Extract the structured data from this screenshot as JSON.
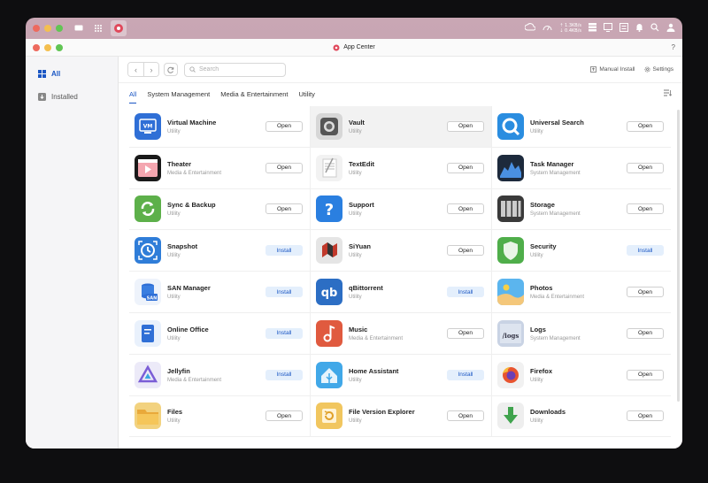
{
  "window": {
    "title": "App Center",
    "help": "?"
  },
  "sysbar": {
    "net_up": "1.3KB/s",
    "net_down": "0.4KB/s"
  },
  "sidebar": {
    "items": [
      {
        "label": "All",
        "icon": "grid-icon",
        "active": true
      },
      {
        "label": "Installed",
        "icon": "download-icon",
        "active": false
      }
    ]
  },
  "toolbar": {
    "search_placeholder": "Search",
    "manual_install": "Manual Install",
    "settings": "Settings"
  },
  "tabs": [
    "All",
    "System Management",
    "Media & Entertainment",
    "Utility"
  ],
  "apps": [
    {
      "name": "Virtual Machine",
      "category": "Utility",
      "action": "Open",
      "icon": "vm-icon",
      "color": "#2f6fd6"
    },
    {
      "name": "Vault",
      "category": "Utility",
      "action": "Open",
      "icon": "vault-icon",
      "color": "#6b6b6b"
    },
    {
      "name": "Universal Search",
      "category": "Utility",
      "action": "Open",
      "icon": "search-app-icon",
      "color": "#2a8de0"
    },
    {
      "name": "Theater",
      "category": "Media & Entertainment",
      "action": "Open",
      "icon": "theater-icon",
      "color": "#111111"
    },
    {
      "name": "TextEdit",
      "category": "Utility",
      "action": "Open",
      "icon": "textedit-icon",
      "color": "#eeeeee"
    },
    {
      "name": "Task Manager",
      "category": "System Management",
      "action": "Open",
      "icon": "task-manager-icon",
      "color": "#1d2a3c"
    },
    {
      "name": "Sync & Backup",
      "category": "Utility",
      "action": "Open",
      "icon": "sync-icon",
      "color": "#5db04a"
    },
    {
      "name": "Support",
      "category": "Utility",
      "action": "Open",
      "icon": "support-icon",
      "color": "#2a7fe0"
    },
    {
      "name": "Storage",
      "category": "System Management",
      "action": "Open",
      "icon": "storage-icon",
      "color": "#444444"
    },
    {
      "name": "Snapshot",
      "category": "Utility",
      "action": "Install",
      "icon": "snapshot-icon",
      "color": "#2f7dd8"
    },
    {
      "name": "SiYuan",
      "category": "Utility",
      "action": "Open",
      "icon": "siyuan-icon",
      "color": "#e5e5e5"
    },
    {
      "name": "Security",
      "category": "Utility",
      "action": "Install",
      "icon": "security-icon",
      "color": "#4fae4a"
    },
    {
      "name": "SAN Manager",
      "category": "Utility",
      "action": "Install",
      "icon": "san-manager-icon",
      "color": "#e9f0fa"
    },
    {
      "name": "qBittorrent",
      "category": "Utility",
      "action": "Install",
      "icon": "qbittorrent-icon",
      "color": "#2c6ec4"
    },
    {
      "name": "Photos",
      "category": "Media & Entertainment",
      "action": "Open",
      "icon": "photos-icon",
      "color": "#4aa6e6"
    },
    {
      "name": "Online Office",
      "category": "Utility",
      "action": "Install",
      "icon": "office-icon",
      "color": "#e9f1fc"
    },
    {
      "name": "Music",
      "category": "Media & Entertainment",
      "action": "Open",
      "icon": "music-icon",
      "color": "#e05a3f"
    },
    {
      "name": "Logs",
      "category": "System Management",
      "action": "Open",
      "icon": "logs-icon",
      "color": "#c9d3e4"
    },
    {
      "name": "Jellyfin",
      "category": "Media & Entertainment",
      "action": "Install",
      "icon": "jellyfin-icon",
      "color": "#eceaf8"
    },
    {
      "name": "Home Assistant",
      "category": "Utility",
      "action": "Install",
      "icon": "home-assistant-icon",
      "color": "#41a8e8"
    },
    {
      "name": "Firefox",
      "category": "Utility",
      "action": "Open",
      "icon": "firefox-icon",
      "color": "#f1f1f1"
    },
    {
      "name": "Files",
      "category": "Utility",
      "action": "Open",
      "icon": "files-icon",
      "color": "#e9b84a"
    },
    {
      "name": "File Version Explorer",
      "category": "Utility",
      "action": "Open",
      "icon": "file-version-icon",
      "color": "#e8b547"
    },
    {
      "name": "Downloads",
      "category": "Utility",
      "action": "Open",
      "icon": "downloads-icon",
      "color": "#eeeeee"
    }
  ],
  "colors": {
    "accent": "#1a56c4",
    "install_bg": "#e4effc"
  }
}
